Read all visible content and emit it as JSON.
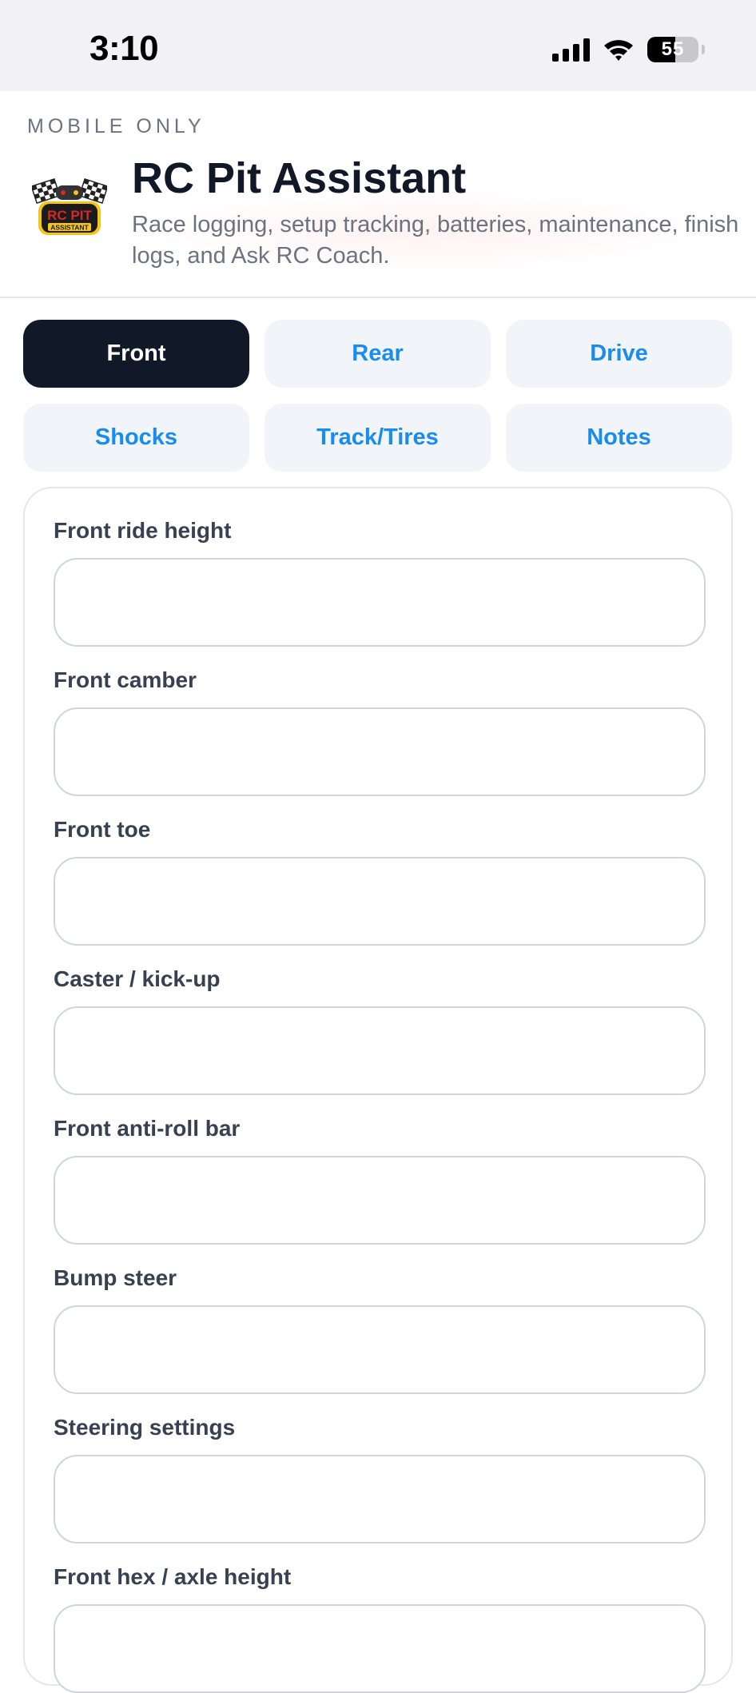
{
  "status_bar": {
    "time": "3:10",
    "battery": "55",
    "icons": [
      "signal-icon",
      "wifi-icon",
      "battery-icon"
    ]
  },
  "header": {
    "eyebrow": "MOBILE ONLY",
    "title": "RC Pit Assistant",
    "subtitle": "Race logging, setup tracking, batteries, maintenance, finish logs, and Ask RC Coach.",
    "logo_lines": [
      "RC PIT",
      "ASSISTANT"
    ]
  },
  "tabs": [
    {
      "label": "Front",
      "active": true
    },
    {
      "label": "Rear",
      "active": false
    },
    {
      "label": "Drive",
      "active": false
    },
    {
      "label": "Shocks",
      "active": false
    },
    {
      "label": "Track/Tires",
      "active": false
    },
    {
      "label": "Notes",
      "active": false
    }
  ],
  "form": {
    "fields": [
      {
        "label": "Front ride height",
        "value": ""
      },
      {
        "label": "Front camber",
        "value": ""
      },
      {
        "label": "Front toe",
        "value": ""
      },
      {
        "label": "Caster / kick-up",
        "value": ""
      },
      {
        "label": "Front anti-roll bar",
        "value": ""
      },
      {
        "label": "Bump steer",
        "value": ""
      },
      {
        "label": "Steering settings",
        "value": ""
      },
      {
        "label": "Front hex / axle height",
        "value": ""
      }
    ]
  },
  "colors": {
    "accent": "#1a8cf0",
    "active_tab": "#111827",
    "tab_bg": "#f1f4f8",
    "logo_red": "#d62828",
    "logo_yellow": "#f5c518"
  }
}
